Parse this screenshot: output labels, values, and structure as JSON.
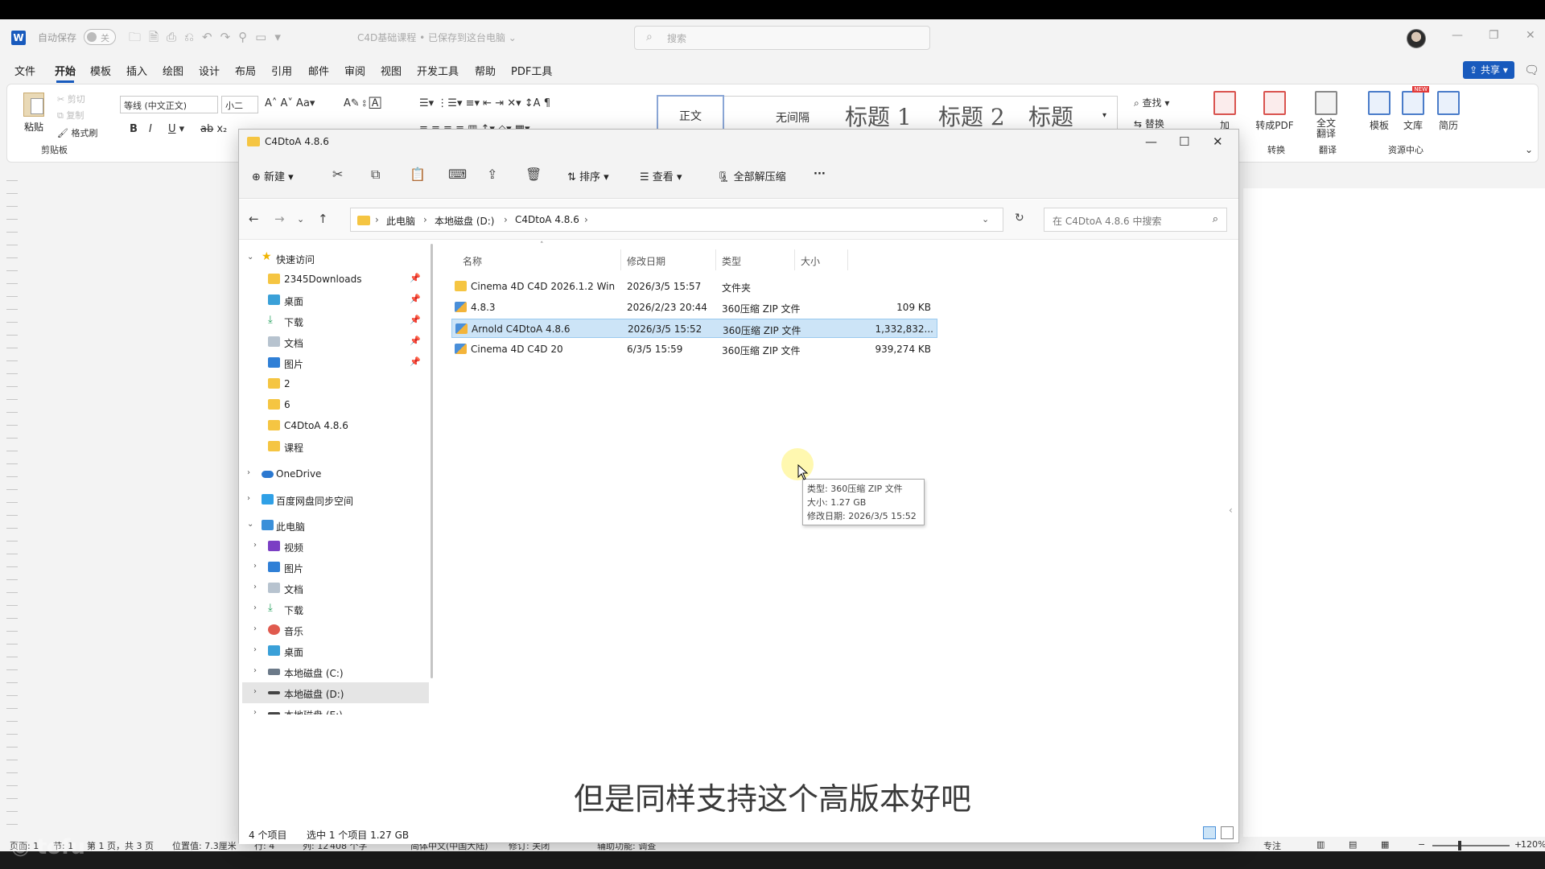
{
  "word": {
    "autosave_label": "自动保存",
    "autosave_state": "关",
    "doc_title": "C4D基础课程 • 已保存到这台电脑 ⌄",
    "search_placeholder": "搜索",
    "tabs": [
      "文件",
      "开始",
      "模板",
      "插入",
      "绘图",
      "设计",
      "布局",
      "引用",
      "邮件",
      "审阅",
      "视图",
      "开发工具",
      "帮助",
      "PDF工具"
    ],
    "active_tab": "开始",
    "share_label": "共享",
    "clipboard": {
      "paste": "粘贴",
      "cut": "剪切",
      "copy": "复制",
      "format_painter": "格式刷",
      "group": "剪贴板"
    },
    "font_name": "等线 (中文正文)",
    "font_size": "小二",
    "styles": [
      "正文",
      "无间隔",
      "标题 1",
      "标题 2",
      "标题"
    ],
    "find": "查找",
    "replace": "替换",
    "add_label": "加",
    "to_pdf": "转成PDF",
    "convert_group": "转换",
    "full_translate": "全文\n翻译",
    "translate_group": "翻译",
    "template": "模板",
    "library": "文库",
    "resume": "简历",
    "resource_group": "资源中心",
    "new_badge": "NEW"
  },
  "explorer": {
    "title": "C4DtoA 4.8.6",
    "toolbar": {
      "new": "新建",
      "sort": "排序",
      "view": "查看",
      "extract_all": "全部解压缩",
      "more": "···"
    },
    "breadcrumb": [
      "此电脑",
      "本地磁盘 (D:)",
      "C4DtoA 4.8.6"
    ],
    "search_placeholder": "在 C4DtoA 4.8.6 中搜索",
    "nav": {
      "quick_access": "快速访问",
      "quick_items": [
        "2345Downloads",
        "桌面",
        "下载",
        "文档",
        "图片",
        "2",
        "6",
        "C4DtoA 4.8.6",
        "课程"
      ],
      "onedrive": "OneDrive",
      "baidu": "百度网盘同步空间",
      "this_pc": "此电脑",
      "pc_items": [
        "视频",
        "图片",
        "文档",
        "下载",
        "音乐",
        "桌面",
        "本地磁盘 (C:)",
        "本地磁盘 (D:)",
        "本地磁盘 (E:)"
      ]
    },
    "columns": [
      "名称",
      "修改日期",
      "类型",
      "大小"
    ],
    "files": [
      {
        "name": "Cinema 4D C4D 2026.1.2 Win",
        "date": "2026/3/5 15:57",
        "type": "文件夹",
        "size": ""
      },
      {
        "name": "4.8.3",
        "date": "2026/2/23 20:44",
        "type": "360压缩 ZIP 文件",
        "size": "109 KB"
      },
      {
        "name": "Arnold C4DtoA 4.8.6",
        "date": "2026/3/5 15:52",
        "type": "360压缩 ZIP 文件",
        "size": "1,332,832..."
      },
      {
        "name": "Cinema 4D C4D 20",
        "date": "6/3/5 15:59",
        "type": "360压缩 ZIP 文件",
        "size": "939,274 KB"
      }
    ],
    "tooltip": {
      "type": "类型: 360压缩 ZIP 文件",
      "size": "大小: 1.27 GB",
      "modified": "修改日期: 2026/3/5 15:52"
    },
    "status": {
      "count": "4 个项目",
      "selected": "选中 1 个项目  1.27 GB"
    }
  },
  "statusbar": {
    "page": "页面: 1",
    "section": "节: 1",
    "pages": "第 1 页，共 3 页",
    "position": "位置值: 7.3厘米",
    "row": "行: 4",
    "col": "列: 12",
    "words": "408 个字",
    "lang": "简体中文(中国大陆)",
    "track": "修订: 关闭",
    "accessibility": "辅助功能: 调查",
    "focus": "专注",
    "zoom": "120%"
  },
  "subtitle": "但是同样支持这个高版本好吧",
  "colors": {
    "accent": "#185abd",
    "selection": "#cce4f7",
    "folder": "#f5c542"
  }
}
